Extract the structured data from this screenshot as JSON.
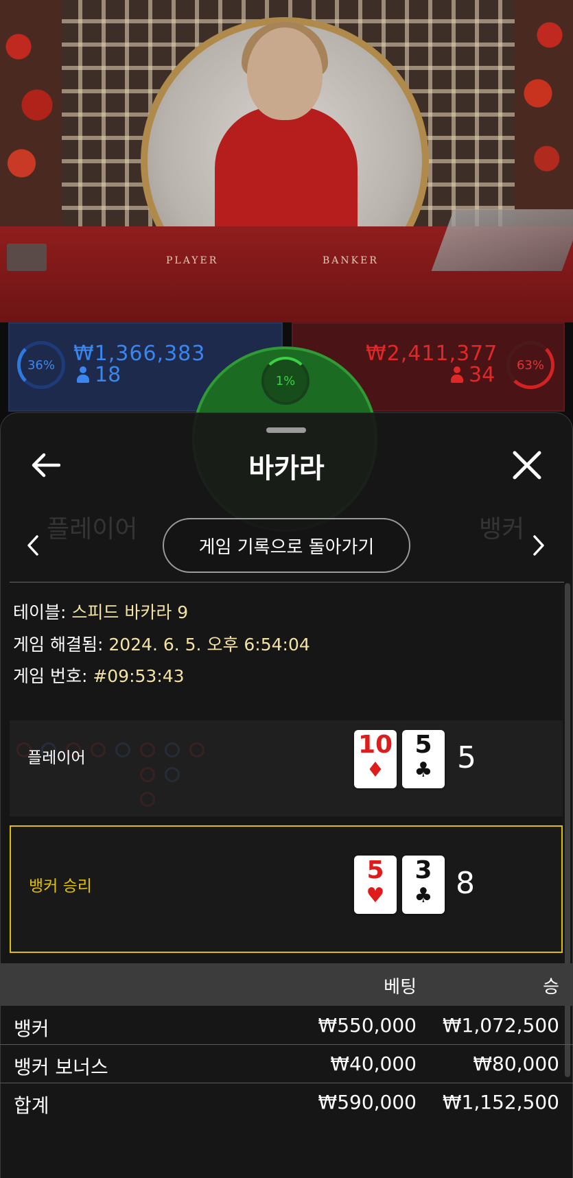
{
  "video": {
    "table_player_label": "PLAYER",
    "table_banker_label": "BANKER"
  },
  "stats": {
    "player_percent": "36%",
    "player_amount": "₩1,366,383",
    "player_count": "18",
    "banker_percent": "63%",
    "banker_amount": "₩2,411,377",
    "banker_count": "34",
    "tie_percent": "1%"
  },
  "panel": {
    "title": "바카라",
    "ghost_left": "플레이어",
    "ghost_right": "뱅커",
    "back_button": "게임 기록으로 돌아가기"
  },
  "info": {
    "table_label": "테이블:",
    "table_value": "스피드 바카라 9",
    "resolved_label": "게임 해결됨:",
    "resolved_value": "2024. 6. 5. 오후 6:54:04",
    "number_label": "게임 번호:",
    "number_value": "#09:53:43"
  },
  "result": {
    "player_label": "플레이어",
    "player_cards": [
      {
        "rank": "10",
        "suit": "♦",
        "color": "red"
      },
      {
        "rank": "5",
        "suit": "♣",
        "color": "black"
      }
    ],
    "player_score": "5",
    "banker_label": "뱅커 승리",
    "banker_cards": [
      {
        "rank": "5",
        "suit": "♥",
        "color": "red"
      },
      {
        "rank": "3",
        "suit": "♣",
        "color": "black"
      }
    ],
    "banker_score": "8",
    "highlight_color": "#e0c100"
  },
  "bets": {
    "headers": {
      "bet": "베팅",
      "win": "승"
    },
    "rows": [
      {
        "name": "뱅커",
        "bet": "₩550,000",
        "win": "₩1,072,500"
      },
      {
        "name": "뱅커 보너스",
        "bet": "₩40,000",
        "win": "₩80,000"
      },
      {
        "name": "합계",
        "bet": "₩590,000",
        "win": "₩1,152,500"
      }
    ]
  },
  "colors": {
    "player_blue": "#3a86ee",
    "banker_red": "#e02828",
    "tie_green": "#3cd045",
    "value_cream": "#f4e3a4"
  }
}
